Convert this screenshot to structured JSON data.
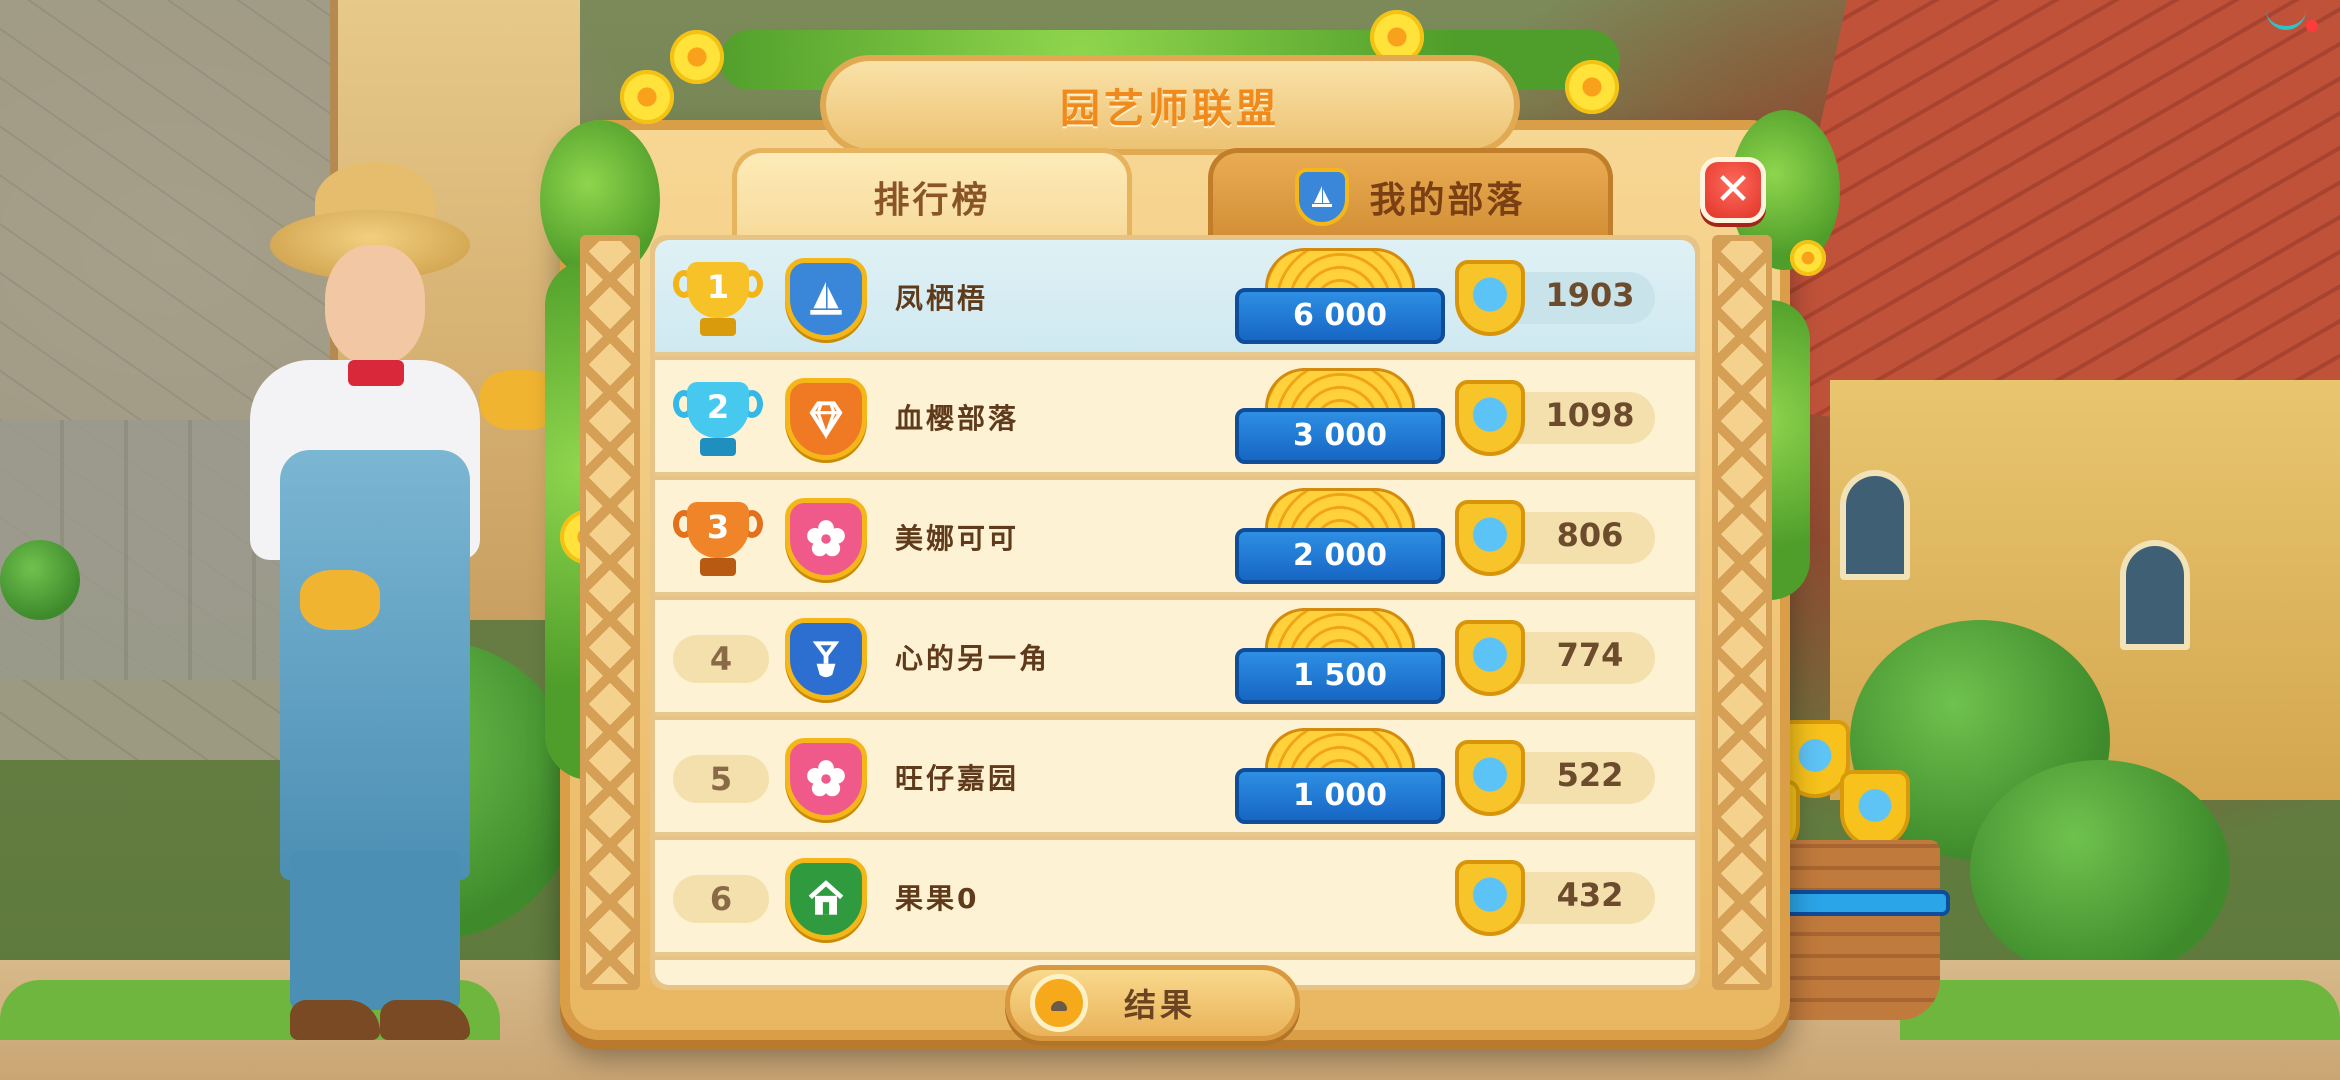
{
  "title": "园艺师联盟",
  "tabs": [
    {
      "label": "排行榜",
      "active": true
    },
    {
      "label": "我的部落",
      "active": false,
      "icon": "sailboat-shield-icon"
    }
  ],
  "close_label": "✕",
  "leaderboard": [
    {
      "rank": "1",
      "rank_style": "gold-trophy",
      "badge_icon": "sailboat-icon",
      "badge_color": "#3a86d8",
      "name": "凤栖梧",
      "reward": "6 000",
      "score": "1903",
      "highlighted": true
    },
    {
      "rank": "2",
      "rank_style": "blue-trophy",
      "badge_icon": "diamond-icon",
      "badge_color": "#f07a24",
      "name": "血樱部落",
      "reward": "3 000",
      "score": "1098",
      "highlighted": false
    },
    {
      "rank": "3",
      "rank_style": "bronze-trophy",
      "badge_icon": "flower-icon",
      "badge_color": "#ef5a8a",
      "name": "美娜可可",
      "reward": "2 000",
      "score": "806",
      "highlighted": false
    },
    {
      "rank": "4",
      "rank_style": "plain",
      "badge_icon": "shovel-icon",
      "badge_color": "#2c6fd1",
      "name": "心的另一角",
      "reward": "1 500",
      "score": "774",
      "highlighted": false
    },
    {
      "rank": "5",
      "rank_style": "plain",
      "badge_icon": "flower-icon",
      "badge_color": "#ef5a8a",
      "name": "旺仔嘉园",
      "reward": "1 000",
      "score": "522",
      "highlighted": false
    },
    {
      "rank": "6",
      "rank_style": "plain",
      "badge_icon": "house-icon",
      "badge_color": "#2f9b3e",
      "name": "果果0",
      "reward": "",
      "score": "432",
      "highlighted": false
    }
  ],
  "results_button": {
    "label": "结果",
    "icon": "alarm-clock-icon"
  },
  "colors": {
    "title": "#f08a1c",
    "gold": "#f5b619",
    "blue_ribbon": "#1766c4",
    "close": "#e0342a"
  }
}
